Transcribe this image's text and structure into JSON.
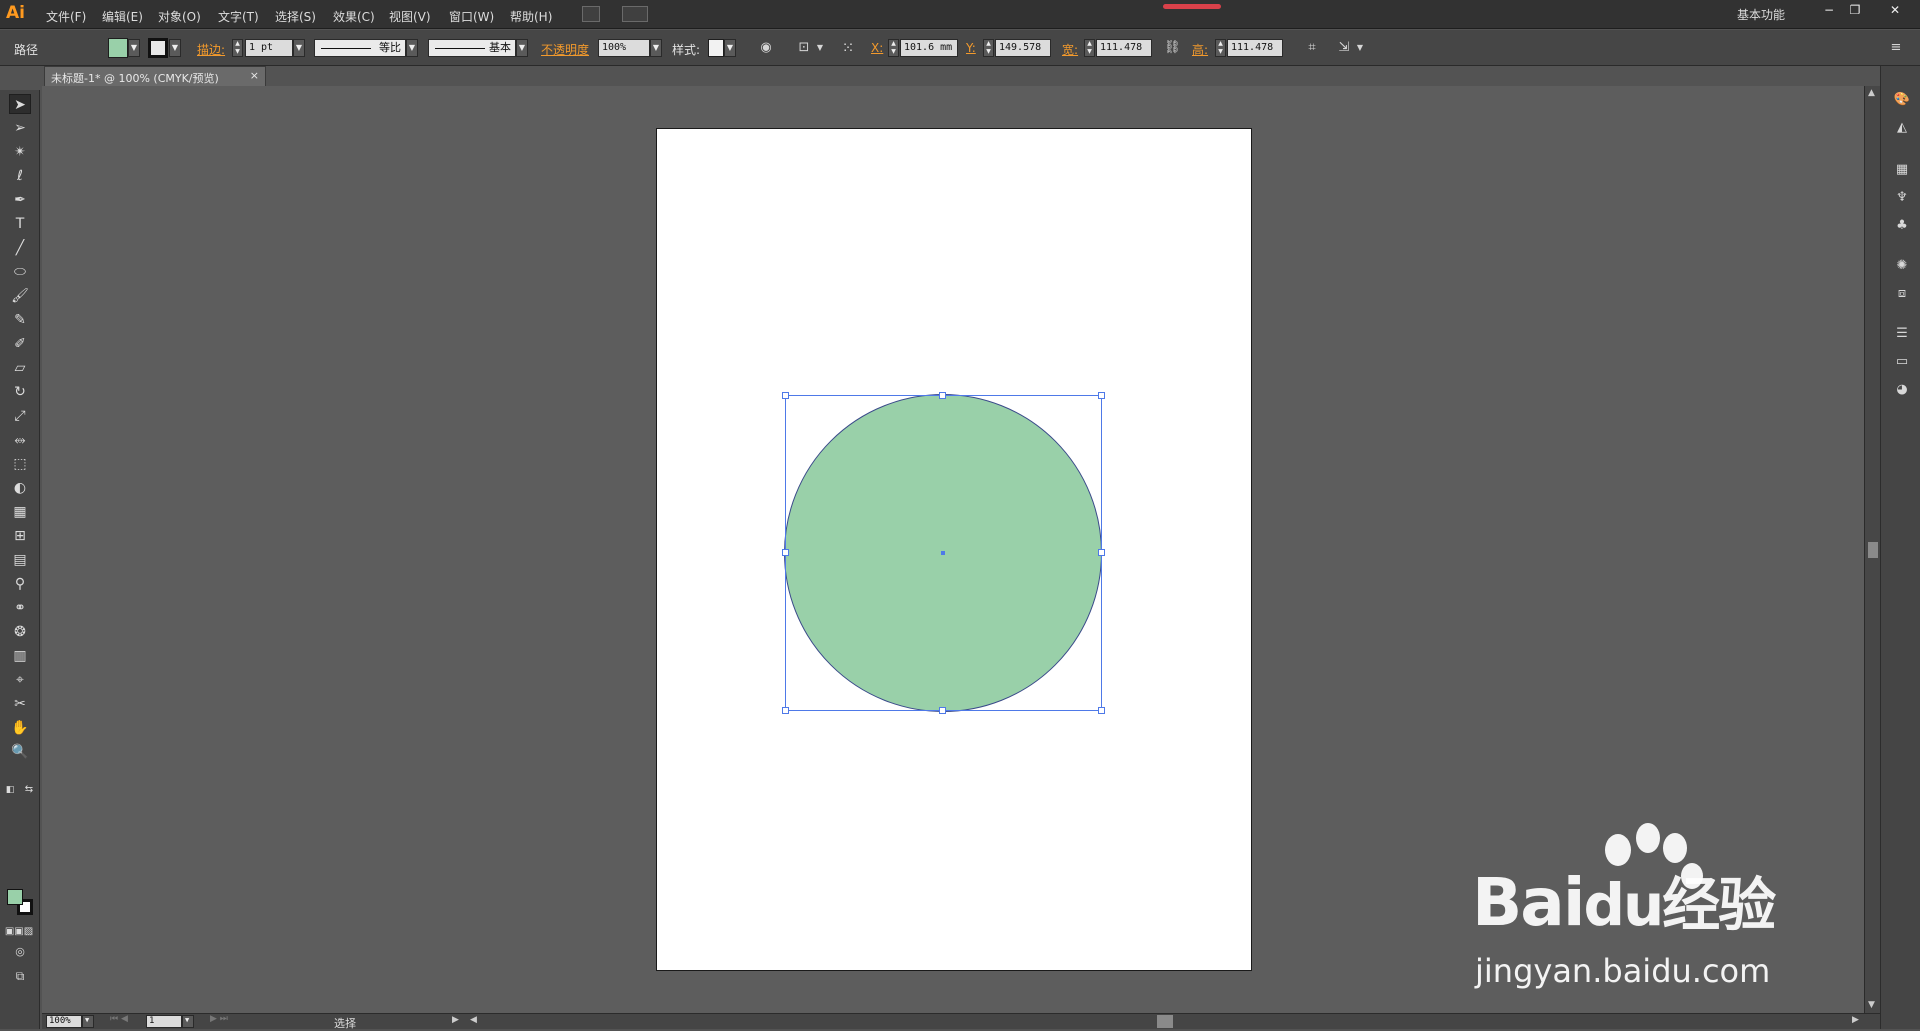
{
  "app": {
    "logo": "Ai"
  },
  "menu": [
    "文件(F)",
    "编辑(E)",
    "对象(O)",
    "文字(T)",
    "选择(S)",
    "效果(C)",
    "视图(V)",
    "窗口(W)",
    "帮助(H)"
  ],
  "workspace": "基本功能",
  "window_controls": {
    "minimize": "−",
    "restore": "❐",
    "close": "✕"
  },
  "control_bar": {
    "object_type": "路径",
    "stroke_label": "描边:",
    "stroke_weight": "1 pt",
    "profile": "等比",
    "brush": "基本",
    "opacity_label": "不透明度",
    "opacity_value": "100%",
    "style_label": "样式:",
    "x_label": "X:",
    "x_value": "101.6 mm",
    "y_label": "Y:",
    "y_value": "149.578",
    "w_label": "宽:",
    "w_value": "111.478",
    "h_label": "高:",
    "h_value": "111.478",
    "fill_color": "#99d0a9",
    "stroke_color": "#1a1a1a"
  },
  "document_tab": {
    "title": "未标题-1* @ 100% (CMYK/预览)",
    "close": "×"
  },
  "status": {
    "zoom": "100%",
    "artboard": "1",
    "text": "选择"
  },
  "watermark": {
    "brand": "Bai",
    "brand_suffix": "du经验",
    "url": "jingyan.baidu.com"
  },
  "colors": {
    "accent_orange": "#f39a2c",
    "selection_blue": "#4e79e8",
    "circle_fill": "#99d0a9"
  }
}
